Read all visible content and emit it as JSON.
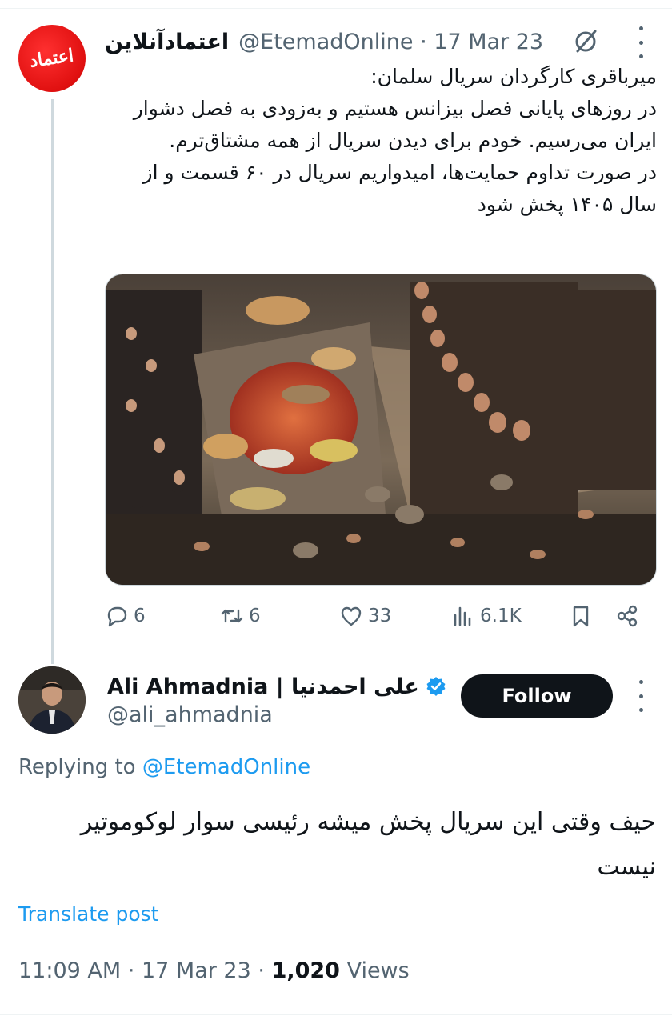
{
  "parent_tweet": {
    "display_name": "اعتمادآنلاین",
    "handle": "@EtemadOnline",
    "separator": "·",
    "date": "17 Mar 23",
    "avatar_text": "اعتماد",
    "text_lines": [
      "میرباقری کارگردان سریال سلمان:",
      "در روزهای پایانی فصل بیزانس هستیم و به‌زودی به فصل دشوار ایران می‌رسیم. خودم برای دیدن سریال از همه مشتاق‌ترم.",
      "در صورت تداوم حمایت‌ها، امیدواریم سریال در ۶۰ قسمت و از سال ۱۴۰۵ پخش شود"
    ],
    "media_icon": "film-still-photo",
    "actions": {
      "replies": "6",
      "reposts": "6",
      "likes": "33",
      "views": "6.1K"
    }
  },
  "reply_tweet": {
    "display_name": "Ali Ahmadnia | علی احمدنیا",
    "handle": "@ali_ahmadnia",
    "follow_label": "Follow",
    "replying_prefix": "Replying to",
    "replying_to": "@EtemadOnline",
    "text": "حیف وقتی این سریال پخش میشه رئیسی سوار لوکوموتیر نیست",
    "translate_label": "Translate post",
    "time": "11:09 AM",
    "date": "17 Mar 23",
    "separator": "·",
    "views_count": "1,020",
    "views_label": "Views"
  },
  "colors": {
    "accent": "#1d9bf0",
    "text_primary": "#0f1419",
    "text_secondary": "#536471",
    "follow_bg": "#0f1419",
    "brand_red": "#e01010"
  },
  "icons": [
    "grok-icon",
    "more-icon",
    "reply-icon",
    "repost-icon",
    "like-icon",
    "views-icon",
    "bookmark-icon",
    "share-icon",
    "verified-icon"
  ]
}
